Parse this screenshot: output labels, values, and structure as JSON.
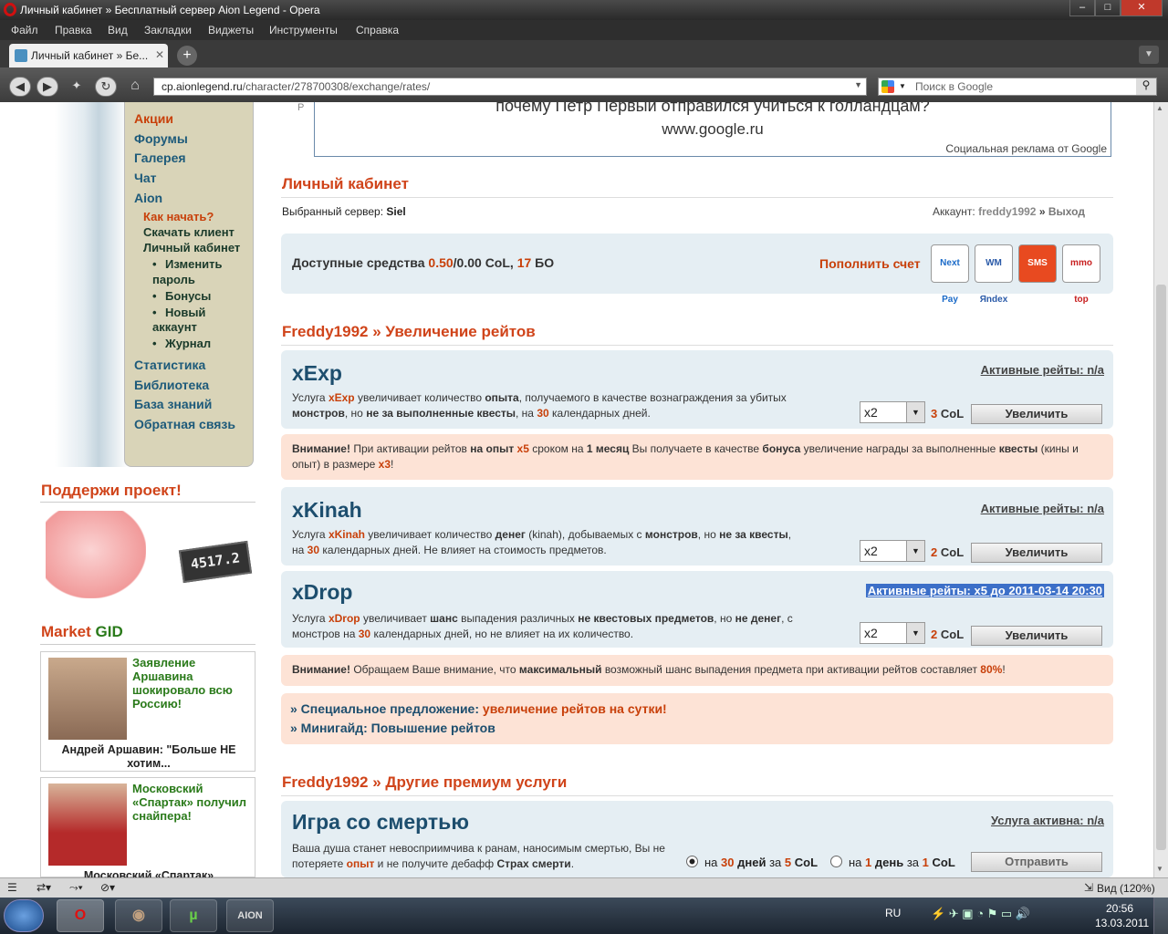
{
  "window": {
    "title": "Личный кабинет » Бесплатный сервер Aion Legend - Opera"
  },
  "menu": [
    "Файл",
    "Правка",
    "Вид",
    "Закладки",
    "Виджеты",
    "Инструменты",
    "Справка"
  ],
  "tab": {
    "label": "Личный кабинет » Бе..."
  },
  "address": {
    "url_host": "cp.aionlegend.ru",
    "url_path": "/character/278700308/exchange/rates/",
    "search_placeholder": "Поиск в Google"
  },
  "ad": {
    "line1": "почему Петр Первый отправился учиться к голландцам?",
    "line2": "www.google.ru",
    "note": "Социальная реклама от Google",
    "side": "Р"
  },
  "sidebar": {
    "items": [
      {
        "label": "Акции",
        "red": true
      },
      {
        "label": "Форумы"
      },
      {
        "label": "Галерея"
      },
      {
        "label": "Чат"
      },
      {
        "label": "Aion"
      }
    ],
    "sub": {
      "how_start": "Как начать?",
      "download": "Скачать клиент",
      "cabinet": "Личный кабинет",
      "change_pwd_1": "Изменить",
      "change_pwd_2": "пароль",
      "bonuses": "Бонусы",
      "new_acc_1": "Новый",
      "new_acc_2": "аккаунт",
      "journal": "Журнал"
    },
    "items2": [
      "Статистика",
      "Библиотека",
      "База знаний",
      "Обратная связь"
    ],
    "support_title": "Поддержи проект!",
    "piggy_counter": "4517.2",
    "market_title_1": "Market",
    "market_title_2": "GID",
    "ads": [
      {
        "headline": "Заявление Аршавина шокировало всю Россию!",
        "caption": "Андрей Аршавин: \"Больше НЕ хотим..."
      },
      {
        "headline": "Московский «Спартак» получил снайпера!",
        "caption": "Московский «Спартак»"
      }
    ]
  },
  "cabinet": {
    "title": "Личный кабинет",
    "server_label": "Выбранный сервер:",
    "server_value": "Siel",
    "account_label": "Аккаунт:",
    "account_value": "freddy1992",
    "sep": "»",
    "logout": "Выход",
    "funds_label": "Доступные средства",
    "funds_value": "0.50",
    "funds_slash": "/0.00",
    "funds_col": "CoL,",
    "funds_bo": "17",
    "funds_bo_label": "БО",
    "topup": "Пополнить счет",
    "pay_icons": [
      "Next Pay",
      "WM Яndex",
      "SMS",
      "mmo top"
    ]
  },
  "rates": {
    "title": "Freddy1992 » Увеличение рейтов",
    "xexp": {
      "name": "xExp",
      "active": "Активные рейты: n/a",
      "select": "x2",
      "price_num": "3",
      "price_cur": "CoL",
      "button": "Увеличить"
    },
    "xkinah": {
      "name": "xKinah",
      "active": "Активные рейты: n/a",
      "select": "x2",
      "price_num": "2",
      "price_cur": "CoL",
      "button": "Увеличить"
    },
    "xdrop": {
      "name": "xDrop",
      "active": "Активные рейты: x5 до 2011-03-14 20:30",
      "select": "x2",
      "price_num": "2",
      "price_cur": "CoL",
      "button": "Увеличить"
    },
    "offer1_a": "» Специальное предложение:",
    "offer1_b": "увеличение рейтов на сутки!",
    "offer2": "» Минигайд: Повышение рейтов"
  },
  "premium": {
    "title": "Freddy1992 » Другие премиум услуги",
    "death": {
      "name": "Игра со смертью",
      "active": "Услуга активна: n/a",
      "line1": "Ваша душа станет невосприимчива к ранам, наносимым смертью,",
      "opt1": "на 30 дней за 5 CoL",
      "opt2": "на 1 день за 1 CoL",
      "button": "Отправить"
    }
  },
  "status": {
    "zoom": "Вид (120%)"
  },
  "taskbar": {
    "lang": "RU",
    "time": "20:56",
    "date": "13.03.2011"
  }
}
